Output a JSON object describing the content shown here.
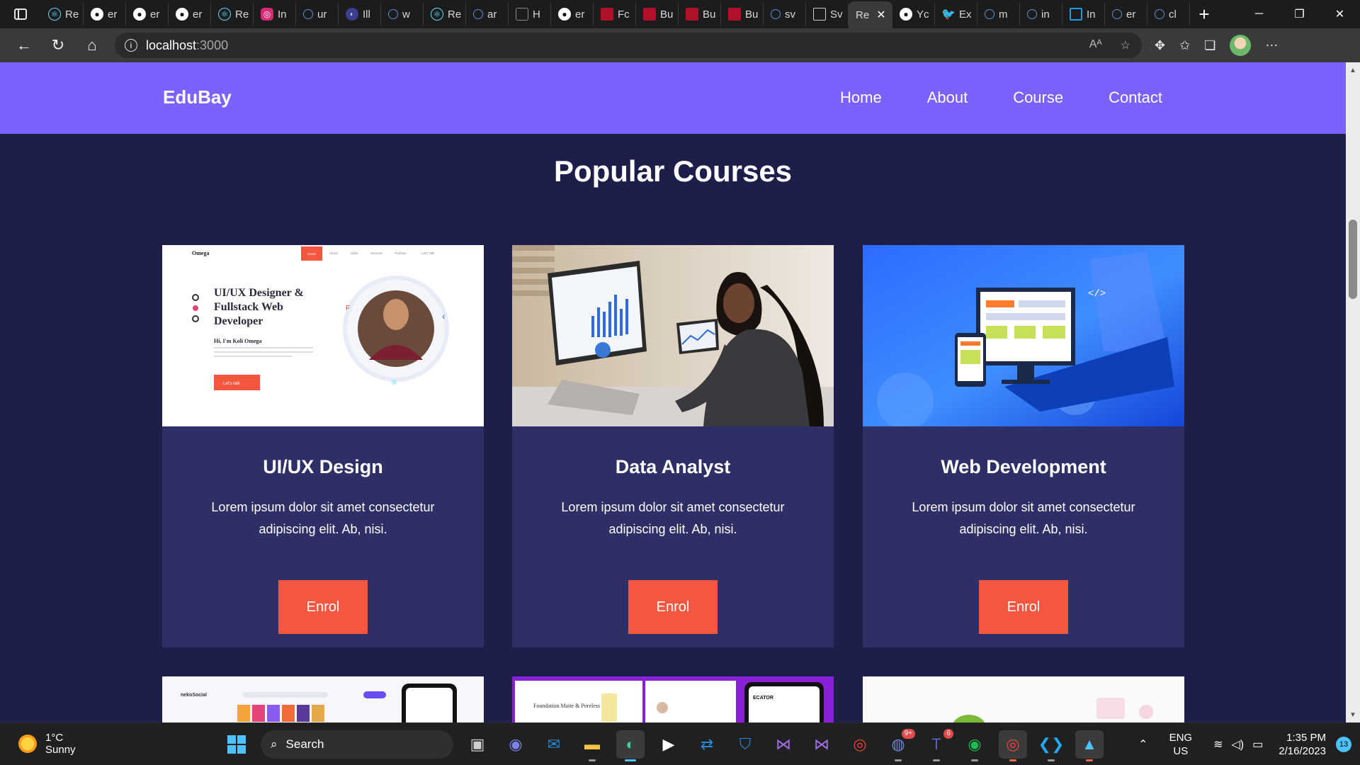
{
  "browser": {
    "tabs": [
      {
        "label": "Re",
        "icon": "react-icon"
      },
      {
        "label": "er",
        "icon": "github-icon"
      },
      {
        "label": "er",
        "icon": "github-icon"
      },
      {
        "label": "er",
        "icon": "github-icon"
      },
      {
        "label": "Re",
        "icon": "react-icon"
      },
      {
        "label": "In",
        "icon": "instagram-icon"
      },
      {
        "label": "ur",
        "icon": "search-icon"
      },
      {
        "label": "Ill",
        "icon": "tor-icon"
      },
      {
        "label": "w",
        "icon": "search-icon"
      },
      {
        "label": "Re",
        "icon": "react-icon"
      },
      {
        "label": "ar",
        "icon": "search-icon"
      },
      {
        "label": "H",
        "icon": "huggingface-icon"
      },
      {
        "label": "er",
        "icon": "github-icon"
      },
      {
        "label": "Fc",
        "icon": "red-site-icon"
      },
      {
        "label": "Bu",
        "icon": "red-site-icon"
      },
      {
        "label": "Bu",
        "icon": "red-site-icon"
      },
      {
        "label": "Bu",
        "icon": "red-site-icon"
      },
      {
        "label": "sv",
        "icon": "search-icon"
      },
      {
        "label": "Sv",
        "icon": "document-icon"
      },
      {
        "label": "Re",
        "icon": "none",
        "active": true
      },
      {
        "label": "Yc",
        "icon": "github-icon"
      },
      {
        "label": "Ex",
        "icon": "twitter-icon"
      },
      {
        "label": "m",
        "icon": "search-icon"
      },
      {
        "label": "in",
        "icon": "search-icon"
      },
      {
        "label": "In",
        "icon": "square-icon"
      },
      {
        "label": "er",
        "icon": "search-icon"
      },
      {
        "label": "cl",
        "icon": "search-icon"
      }
    ],
    "address": {
      "host": "localhost",
      "port": ":3000"
    }
  },
  "site": {
    "brand": "EduBay",
    "nav": [
      "Home",
      "About",
      "Course",
      "Contact"
    ],
    "section_title": "Popular Courses",
    "courses": [
      {
        "title": "UI/UX Design",
        "description": "Lorem ipsum dolor sit amet consectetur adipiscing elit. Ab, nisi.",
        "button": "Enrol",
        "thumb": {
          "logo": "Omega",
          "menu": [
            "Home",
            "About",
            "Skills",
            "Services",
            "Portfolio",
            "Let's Talk"
          ],
          "headline": "UI/UX Designer & Fullstack Web Developer",
          "greeting": "Hi, I'm Koli Omega",
          "cta": "Let's talk"
        }
      },
      {
        "title": "Data Analyst",
        "description": "Lorem ipsum dolor sit amet consectetur adipiscing elit. Ab, nisi.",
        "button": "Enrol"
      },
      {
        "title": "Web Development",
        "description": "Lorem ipsum dolor sit amet consectetur adipiscing elit. Ab, nisi.",
        "button": "Enrol"
      }
    ],
    "next_row_labels": {
      "first": "nekoSocial",
      "second_a": "Foundation Matte & Poreless",
      "second_b": "ECATOR"
    }
  },
  "taskbar": {
    "weather": {
      "temp": "1°C",
      "condition": "Sunny"
    },
    "search_label": "Search",
    "badges": {
      "discord": "9+",
      "teams": "6"
    },
    "lang": {
      "line1": "ENG",
      "line2": "US"
    },
    "clock": {
      "time": "1:35 PM",
      "date": "2/16/2023"
    },
    "notifications": "13"
  },
  "colors": {
    "navbar": "#7b61ff",
    "page_bg": "#1d1f4a",
    "card_bg": "#2e2f66",
    "button": "#f5563f"
  }
}
